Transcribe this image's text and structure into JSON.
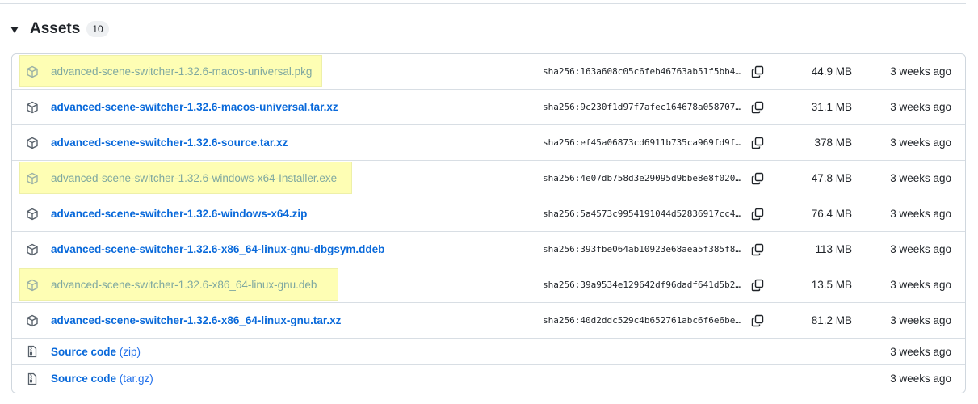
{
  "assets": {
    "title": "Assets",
    "count": "10",
    "items": [
      {
        "name": "advanced-scene-switcher-1.32.6-macos-universal.pkg",
        "sha": "sha256:163a608c05c6feb46763ab51f5bb4…",
        "size": "44.9 MB",
        "date": "3 weeks ago",
        "highlighted": true
      },
      {
        "name": "advanced-scene-switcher-1.32.6-macos-universal.tar.xz",
        "sha": "sha256:9c230f1d97f7afec164678a058707…",
        "size": "31.1 MB",
        "date": "3 weeks ago",
        "highlighted": false
      },
      {
        "name": "advanced-scene-switcher-1.32.6-source.tar.xz",
        "sha": "sha256:ef45a06873cd6911b735ca969fd9f…",
        "size": "378 MB",
        "date": "3 weeks ago",
        "highlighted": false
      },
      {
        "name": "advanced-scene-switcher-1.32.6-windows-x64-Installer.exe",
        "sha": "sha256:4e07db758d3e29095d9bbe8e8f020…",
        "size": "47.8 MB",
        "date": "3 weeks ago",
        "highlighted": true
      },
      {
        "name": "advanced-scene-switcher-1.32.6-windows-x64.zip",
        "sha": "sha256:5a4573c9954191044d52836917cc4…",
        "size": "76.4 MB",
        "date": "3 weeks ago",
        "highlighted": false
      },
      {
        "name": "advanced-scene-switcher-1.32.6-x86_64-linux-gnu-dbgsym.ddeb",
        "sha": "sha256:393fbe064ab10923e68aea5f385f8…",
        "size": "113 MB",
        "date": "3 weeks ago",
        "highlighted": false
      },
      {
        "name": "advanced-scene-switcher-1.32.6-x86_64-linux-gnu.deb",
        "sha": "sha256:39a9534e129642df96dadf641d5b2…",
        "size": "13.5 MB",
        "date": "3 weeks ago",
        "highlighted": true
      },
      {
        "name": "advanced-scene-switcher-1.32.6-x86_64-linux-gnu.tar.xz",
        "sha": "sha256:40d2ddc529c4b652761abc6f6e6be…",
        "size": "81.2 MB",
        "date": "3 weeks ago",
        "highlighted": false
      }
    ],
    "source_items": [
      {
        "label": "Source code",
        "suffix": "(zip)",
        "date": "3 weeks ago"
      },
      {
        "label": "Source code",
        "suffix": "(tar.gz)",
        "date": "3 weeks ago"
      }
    ]
  },
  "colors": {
    "link": "#0969da",
    "highlight": "#fefeb4",
    "border": "#d0d7de"
  },
  "icons": {
    "asset": "package-icon",
    "copy": "copy-icon",
    "source": "file-zip-icon",
    "caret": "triangle-down-icon"
  }
}
